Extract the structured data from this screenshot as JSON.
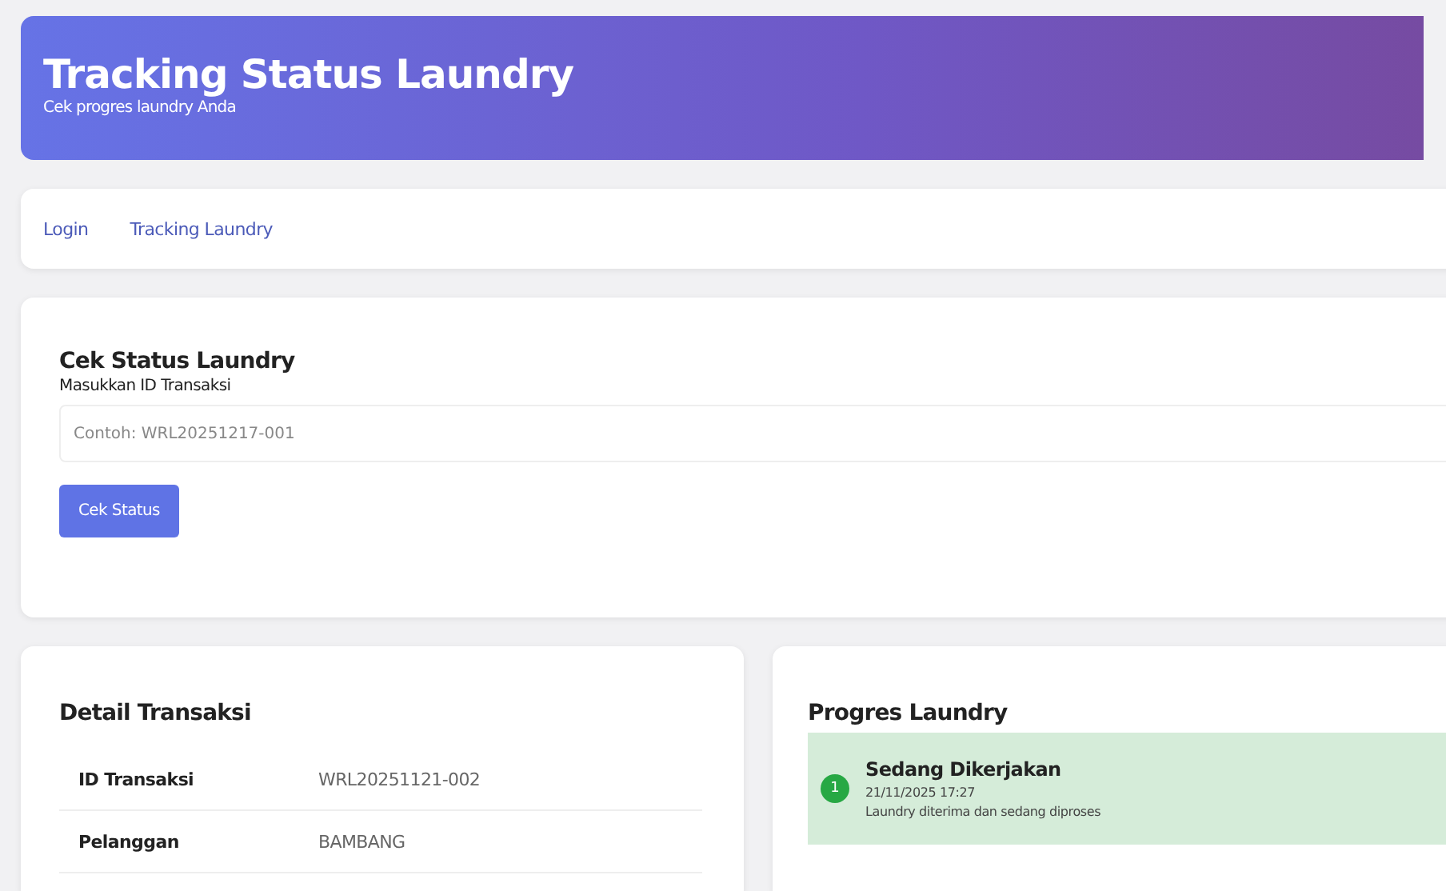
{
  "header": {
    "title": "Tracking Status Laundry",
    "subtitle": "Cek progres laundry Anda"
  },
  "nav": [
    {
      "label": "Login"
    },
    {
      "label": "Tracking Laundry"
    }
  ],
  "search": {
    "title": "Cek Status Laundry",
    "label": "Masukkan ID Transaksi",
    "placeholder": "Contoh: WRL20251217-001",
    "button": "Cek Status"
  },
  "detail": {
    "title": "Detail Transaksi",
    "rows": [
      {
        "label": "ID Transaksi",
        "value": "WRL20251121-002"
      },
      {
        "label": "Pelanggan",
        "value": "BAMBANG"
      }
    ]
  },
  "progress": {
    "title": "Progres Laundry",
    "steps": [
      {
        "number": "1",
        "status": "Sedang Dikerjakan",
        "time": "21/11/2025 17:27",
        "note": "Laundry diterima dan sedang diproses"
      }
    ]
  }
}
